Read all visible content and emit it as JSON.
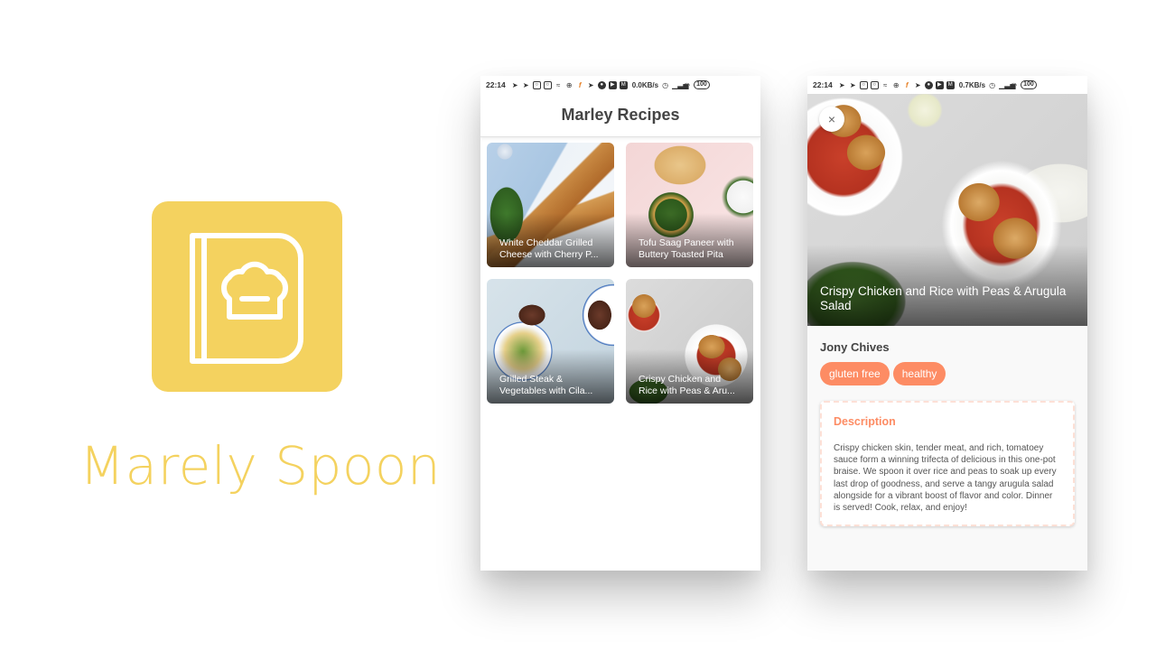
{
  "brand": {
    "name": "Marely Spoon",
    "logo_icon": "recipe-book-chef-hat-icon",
    "color": "#f4d25f"
  },
  "status_bar_list": {
    "time": "22:14",
    "icons": [
      "telegram-icon",
      "telegram-icon",
      "instagram-icon",
      "instagram-icon",
      "app-icon",
      "globe-icon",
      "app-orange-icon",
      "telegram-icon",
      "drop-icon",
      "youtube-icon",
      "mail-icon"
    ],
    "net_speed": "0.0KB/s",
    "alarm_icon": "alarm-icon",
    "signal_icon": "signal-icon",
    "wifi_icon": "wifi-icon",
    "battery": "100"
  },
  "status_bar_detail": {
    "time": "22:14",
    "net_speed": "0.7KB/s",
    "battery": "100"
  },
  "list_screen": {
    "title": "Marley Recipes",
    "recipes": [
      {
        "title_line1": "White Cheddar Grilled",
        "title_line2": "Cheese with Cherry P..."
      },
      {
        "title_line1": "Tofu Saag Paneer with",
        "title_line2": "Buttery Toasted Pita"
      },
      {
        "title_line1": "Grilled Steak &",
        "title_line2": "Vegetables with Cila..."
      },
      {
        "title_line1": "Crispy Chicken and",
        "title_line2": "Rice with Peas & Aru..."
      }
    ]
  },
  "detail_screen": {
    "close_icon": "×",
    "title": "Crispy Chicken and Rice with Peas & Arugula Salad",
    "author": "Jony Chives",
    "tags": [
      "gluten free",
      "healthy"
    ],
    "description_heading": "Description",
    "description": "Crispy chicken skin, tender meat, and rich, tomatoey sauce form a winning trifecta of delicious in this one-pot braise. We spoon it over rice and peas to soak up every last drop of goodness, and serve a tangy arugula salad alongside for a vibrant boost of flavor and color. Dinner is served! Cook, relax, and enjoy!",
    "accent_color": "#fd8c64"
  }
}
